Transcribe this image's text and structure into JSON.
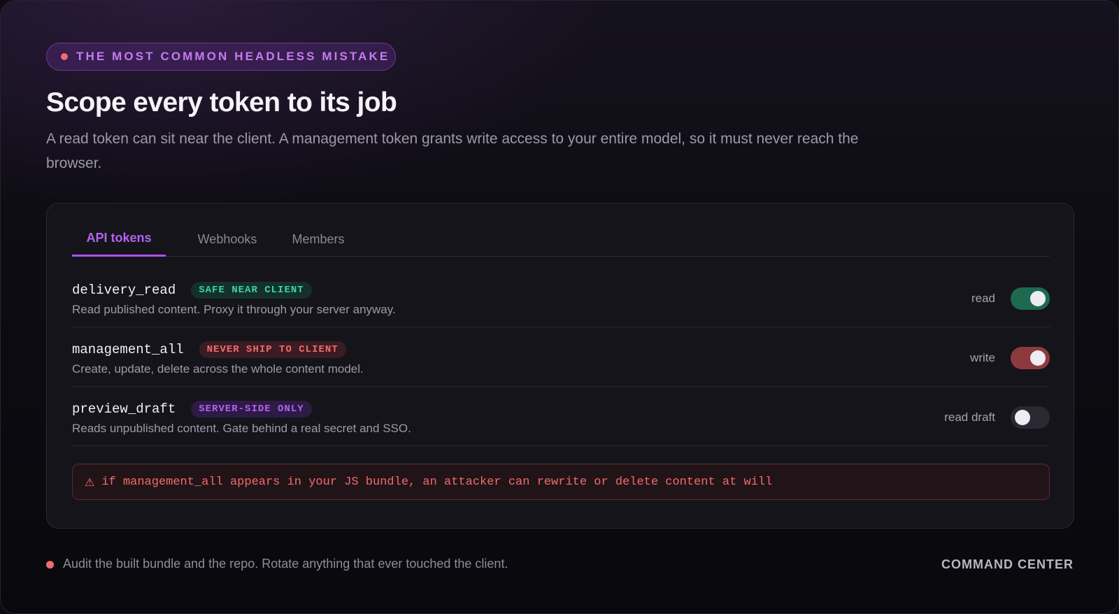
{
  "eyebrow": {
    "label": "THE MOST COMMON HEADLESS MISTAKE"
  },
  "heading": {
    "title": "Scope every token to its job",
    "subtitle": "A read token can sit near the client. A management token grants write access to your entire model, so it must never reach the browser."
  },
  "tabs": [
    {
      "label": "API tokens",
      "active": true
    },
    {
      "label": "Webhooks",
      "active": false
    },
    {
      "label": "Members",
      "active": false
    }
  ],
  "tokens": [
    {
      "name": "delivery_read",
      "badge": "SAFE NEAR CLIENT",
      "badge_color": "#3dd6a1",
      "description": "Read published content. Proxy it through your server anyway.",
      "permission": "read",
      "enabled": true,
      "toggle_color": "#1d6a50"
    },
    {
      "name": "management_all",
      "badge": "NEVER SHIP TO CLIENT",
      "badge_color": "#f26b6b",
      "description": "Create, update, delete across the whole content model.",
      "permission": "write",
      "enabled": true,
      "toggle_color": "#8d3a3e"
    },
    {
      "name": "preview_draft",
      "badge": "SERVER-SIDE ONLY",
      "badge_color": "#b462ef",
      "description": "Reads unpublished content. Gate behind a real secret and SSO.",
      "permission": "read draft",
      "enabled": false,
      "toggle_color": "#2a2933"
    }
  ],
  "warning": {
    "icon": "warning-icon",
    "glyph": "⚠",
    "text": "if management_all appears in your JS bundle, an attacker can rewrite or delete content at will"
  },
  "footer": {
    "note": "Audit the built bundle and the repo. Rotate anything that ever touched the client.",
    "brand": "COMMAND CENTER"
  },
  "colors": {
    "accent": "#a855f7",
    "danger": "#f26b6b",
    "safe": "#3dd6a1"
  }
}
